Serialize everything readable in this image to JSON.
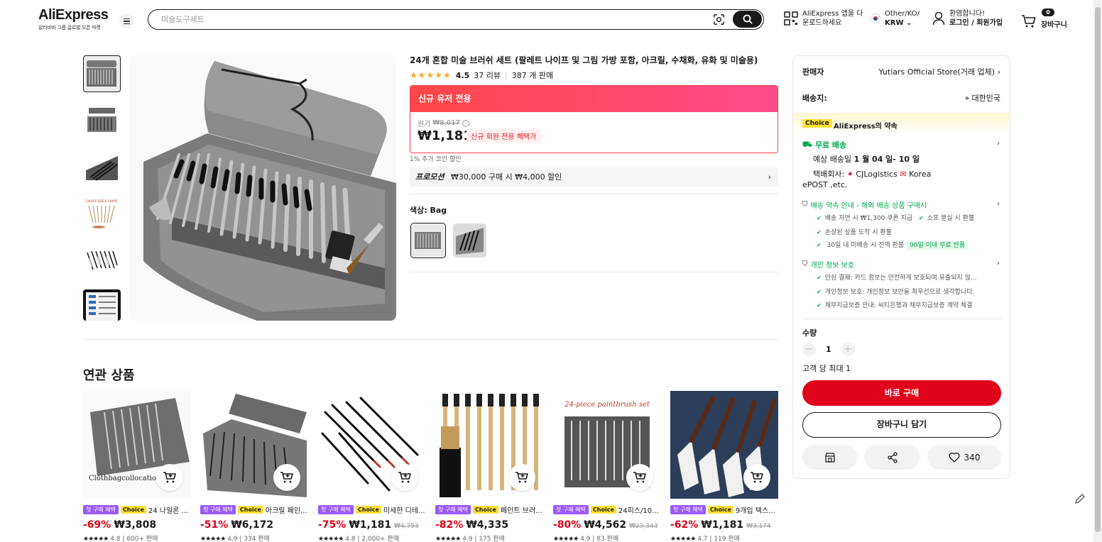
{
  "header": {
    "logo": "AliExpress",
    "logo_sub": "알리바바 그룹 글로벌 오픈 마켓",
    "search_placeholder": "미술도구세트",
    "app_line1": "AliExpress 앱을 다",
    "app_line2": "운로드하세요",
    "locale_line1": "Other/KO/",
    "locale_line2": "KRW",
    "account_line1": "환영합니다!",
    "account_line2": "로그인 / 회원가입",
    "cart_count": "0",
    "cart_label": "장바구니"
  },
  "product": {
    "title": "24개 혼합 미술 브러쉬 세트 (팔레트 나이프 및 그림 가방 포함, 아크릴, 수채화, 유화 및 미술용)",
    "stars": "★★★★★",
    "rating": "4.5",
    "reviews": "37 리뷰",
    "sold": "387 개 판매",
    "promo_header": "신규 유저 전용",
    "orig_label": "원가",
    "orig_price": "₩8,017",
    "price": "₩1,181",
    "price_tag": "신규 회원 전용 혜택가",
    "coin_note": "1% 추가 코인 할인",
    "promotion_label": "프로모션",
    "promotion_text": "₩30,000 구매 시 ₩4,000 할인",
    "color_label": "색상: Bag"
  },
  "panel": {
    "seller_label": "판매자",
    "seller_value": "Yutiars Official Store(거래 업체)",
    "ship_label": "배송지:",
    "ship_value": "대한민국",
    "choice_badge": "Choice",
    "choice_title": "AliExpress의 약속",
    "free_ship": "무료 배송",
    "eta_prefix": "예상 배송일",
    "eta_value": "1 월 04 일- 10 일",
    "courier_label": "택배회사:",
    "courier_value": "CJLogistics",
    "courier_value2": "Korea",
    "courier_line2": "ePOST ,etc.",
    "guarantee_title": "배송 약속 안내 - 해외 배송 상품 구매시",
    "g1": "배송 지연 시 ₩1,300 쿠폰 지급",
    "g2": "소포 분실 시 환불",
    "g3": "손상된 상품 도착 시 환불",
    "g4": "30일 내 미배송 시 전액 환불",
    "g4_tag": "90일 이내 무료 반품",
    "privacy_title": "개인 정보 보호",
    "p1": "안심 결제: 카드 정보는 안전하게 보호되며 유출되지 않...",
    "p2": "개인정보 보호: 개인정보 보안을 최우선으로 생각합니다.",
    "p3": "채무지급보증 안내: 씨티은행과 채무지급보증 계약 체결",
    "qty_label": "수량",
    "qty_value": "1",
    "qty_max": "고객 당 최대 1",
    "buy_now": "바로 구매",
    "add_cart": "장바구니 담기",
    "wish_count": "340"
  },
  "related": {
    "title": "연관 상품",
    "tag_first": "첫 구매 혜택",
    "tag_choice": "Choice",
    "items": [
      {
        "name": "24 나일론 ...",
        "discount": "-69%",
        "price": "₩3,808",
        "orig": "",
        "rating": "4.8",
        "sold": "600+ 판매"
      },
      {
        "name": "아크릴 페인...",
        "discount": "-51%",
        "price": "₩6,172",
        "orig": "",
        "rating": "4.9",
        "sold": "334 판매"
      },
      {
        "name": "미세한 디테...",
        "discount": "-75%",
        "price": "₩1,181",
        "orig": "₩4,753",
        "rating": "4.8",
        "sold": "2,000+ 판매"
      },
      {
        "name": "페인트 브러...",
        "discount": "-82%",
        "price": "₩4,335",
        "orig": "",
        "rating": "4.9",
        "sold": "175 판매"
      },
      {
        "name": "24피스/10...",
        "discount": "-80%",
        "price": "₩4,562",
        "orig": "₩23,343",
        "rating": "4.9",
        "sold": "83 판매"
      },
      {
        "name": "9개입 텍스...",
        "discount": "-62%",
        "price": "₩1,181",
        "orig": "₩3,174",
        "rating": "4.7",
        "sold": "119 판매"
      }
    ],
    "card1_caption": "Clothbagcollocation"
  },
  "colors": {
    "accent_red": "#e0011b",
    "promo_gradient_start": "#ff4747",
    "promo_gradient_end": "#ff4a8b",
    "choice_yellow": "#ffe033",
    "guarantee_green": "#00a650",
    "first_purchase_purple": "#9b59ff"
  }
}
